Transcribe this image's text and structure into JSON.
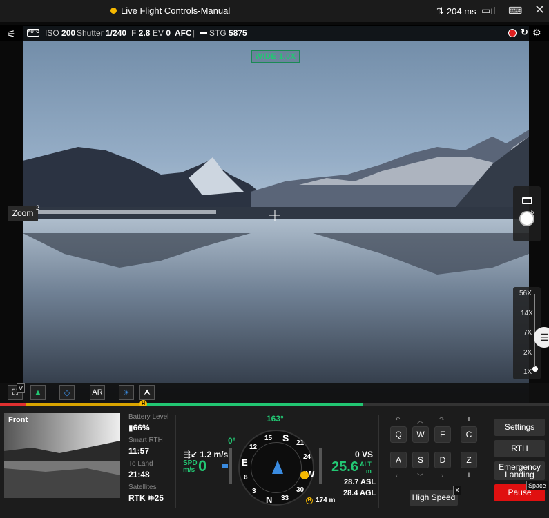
{
  "title_bar": {
    "title": "Live Flight Controls-Manual",
    "status_color": "#f5b800",
    "latency": "204 ms"
  },
  "camera": {
    "iso_label": "ISO",
    "iso": "200",
    "shutter_label": "Shutter",
    "shutter": "1/240",
    "fstop_label": "F",
    "fstop": "2.8",
    "ev_label": "EV",
    "ev": "0",
    "focus": "AFC",
    "storage_label": "STG",
    "storage": "5875",
    "lens_label": "WIDE 1.0X",
    "auto_badge": "AUTO"
  },
  "zoom_button": {
    "label": "Zoom",
    "shortcut": "2"
  },
  "zoom_levels": [
    "56X",
    "14X",
    "7X",
    "2X",
    "1X"
  ],
  "side_button_badge": "5",
  "toolbar": {
    "first_badge": "V",
    "ar_label": "AR"
  },
  "fpv": {
    "label": "Front"
  },
  "status": {
    "battery_label": "Battery Level",
    "battery": "66%",
    "rth_label": "Smart RTH",
    "rth": "11:57",
    "land_label": "To Land",
    "land": "21:48",
    "sat_label": "Satellites",
    "rtk": "RTK",
    "sat_count": "25"
  },
  "telemetry": {
    "heading": "163°",
    "pitch": "0°",
    "wind": "1.2 m/s",
    "spd_label": "SPD",
    "spd_unit": "m/s",
    "spd": "0",
    "vs": "0 VS",
    "alt": "25.6",
    "alt_label": "ALT",
    "alt_unit": "m",
    "asl": "28.7 ASL",
    "agl": "28.4 AGL",
    "home_dist": "174 m",
    "home_marker": "H",
    "compass_labels": [
      "S",
      "21",
      "24",
      "W",
      "30",
      "33",
      "N",
      "3",
      "6",
      "E",
      "12",
      "15"
    ]
  },
  "keys": {
    "row1": [
      "Q",
      "W",
      "E",
      "C"
    ],
    "row2": [
      "A",
      "S",
      "D",
      "Z"
    ]
  },
  "buttons": {
    "settings": "Settings",
    "rth": "RTH",
    "emergency1": "Emergency",
    "emergency2": "Landing",
    "pause": "Pause",
    "pause_key": "Space",
    "high_speed": "High Speed",
    "high_speed_key": "X"
  },
  "colors": {
    "accent_green": "#22c773",
    "pause_red": "#e01010",
    "rec_red": "#e02020"
  }
}
